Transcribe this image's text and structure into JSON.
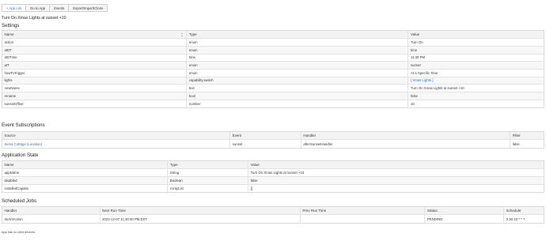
{
  "toolbar": {
    "app_list": "< App List",
    "goto_app": "Go to App",
    "events": "Events",
    "export": "Export/Import/Clone"
  },
  "page_title": "Turn On Xmas Lights at sunset +10",
  "settings": {
    "title": "Settings",
    "headers": [
      "Name",
      "Type",
      "Value"
    ],
    "rows": [
      {
        "name": "action",
        "type": "enum",
        "value": "Turn On"
      },
      {
        "name": "atDT",
        "type": "enum",
        "value": "time"
      },
      {
        "name": "atDTime",
        "type": "time",
        "value": "11:30 PM"
      },
      {
        "name": "atT",
        "type": "enum",
        "value": "sunset"
      },
      {
        "name": "howToTrigger",
        "type": "enum",
        "value": "At a Specific Time"
      },
      {
        "name": "lights",
        "type": "capability.switch",
        "value": "[ Xmas Lights ]"
      },
      {
        "name": "newName",
        "type": "text",
        "value": "Turn On Xmas Lights at sunset +10"
      },
      {
        "name": "rename",
        "type": "bool",
        "value": "false"
      },
      {
        "name": "sunsetOffset",
        "type": "number",
        "value": "10"
      }
    ]
  },
  "events": {
    "title": "Event Subscriptions",
    "headers": [
      "Source",
      "Event",
      "Handler",
      "Filter"
    ],
    "rows": [
      {
        "source": "Siena Cottage (Location)",
        "event": "sunset",
        "handler": "afterSunsetHandler",
        "filter": "false"
      }
    ]
  },
  "state": {
    "title": "Application State",
    "headers": [
      "Name",
      "Type",
      "Value"
    ],
    "rows": [
      {
        "name": "appName",
        "type": "String",
        "value": "Turn On Xmas Lights at sunset +10"
      },
      {
        "name": "disabled",
        "type": "Boolean",
        "value": "false"
      },
      {
        "name": "installedCapabs",
        "type": "ArrayList",
        "value": "[]"
      }
    ]
  },
  "jobs": {
    "title": "Scheduled Jobs",
    "headers": [
      "Handler",
      "Next Run Time",
      "Prev Run Time",
      "Status",
      "Schedule"
    ],
    "rows": [
      {
        "handler": "doAntAction",
        "next": "2023-12-07 11:30:00 PM EST",
        "prev": "",
        "status": "PENDING",
        "schedule": "0 30 23 * * ?"
      }
    ]
  },
  "footer": "App has no child devices."
}
